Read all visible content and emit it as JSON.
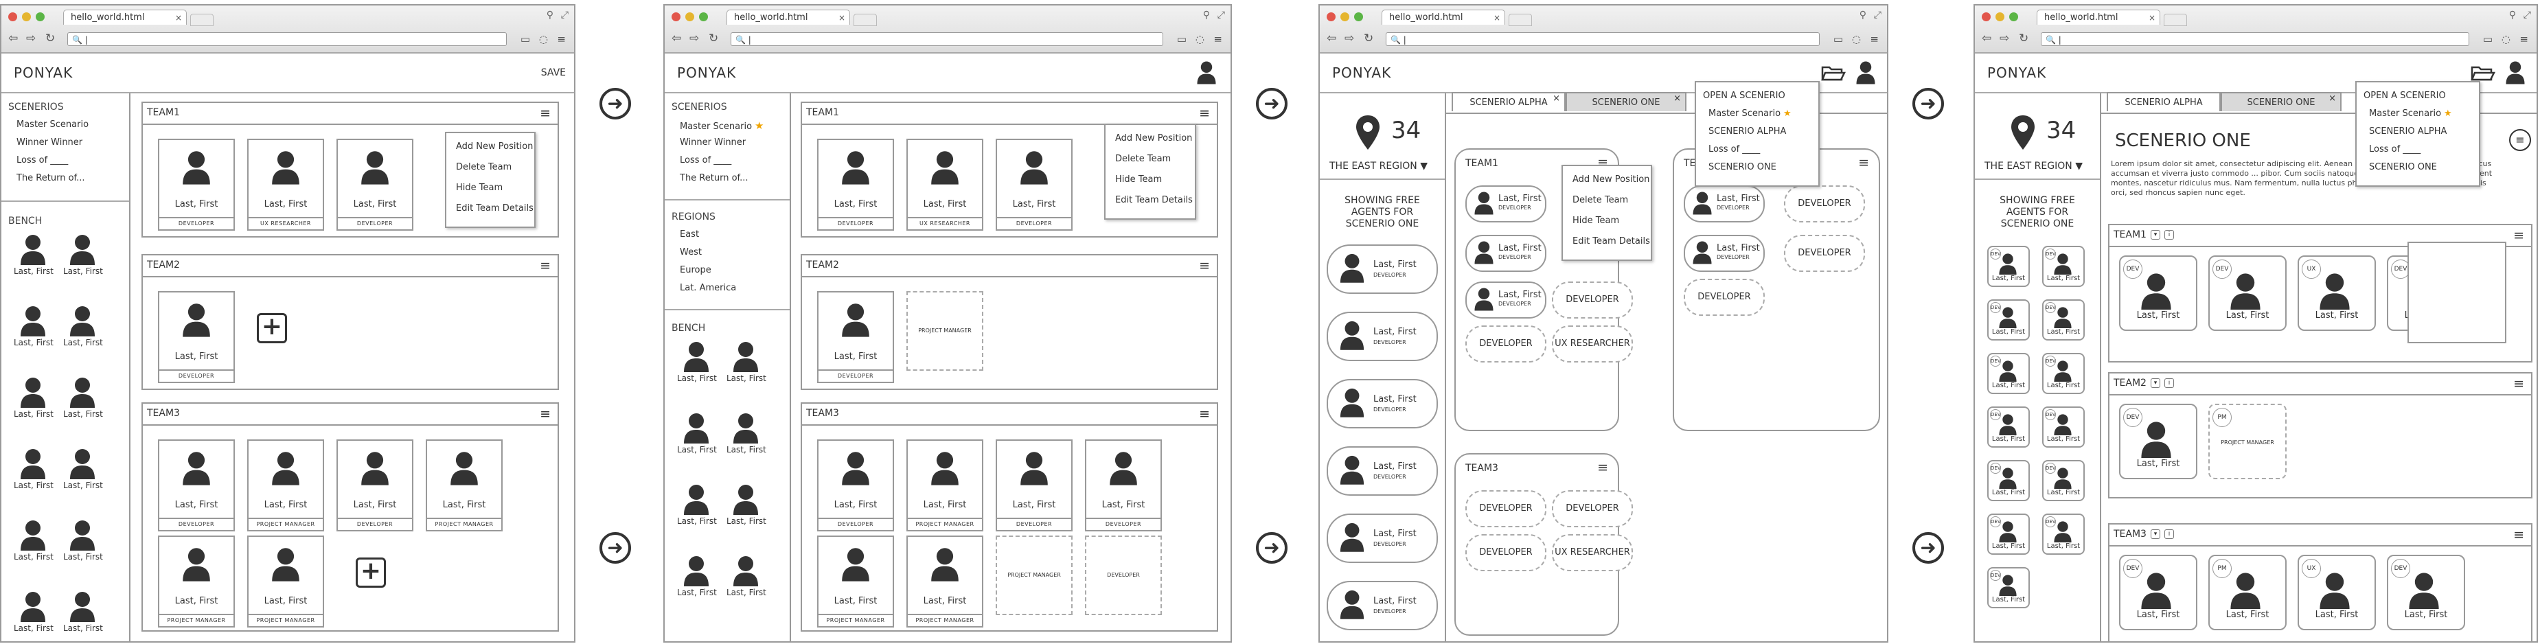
{
  "browser": {
    "tab_title": "hello_world.html",
    "tab_close": "×",
    "url_value": "|"
  },
  "app": {
    "logo": "PONYAK",
    "save": "SAVE"
  },
  "panel1": {
    "sidebar": {
      "scenarios_heading": "SCENERIOS",
      "scenarios": [
        "Master Scenario",
        "Winner Winner",
        "Loss of ____",
        "The Return of..."
      ],
      "bench_heading": "BENCH"
    },
    "teams": [
      {
        "title": "TEAM1",
        "members": [
          {
            "name": "Last, First",
            "role": "DEVELOPER"
          },
          {
            "name": "Last, First",
            "role": "UX RESEARCHER"
          },
          {
            "name": "Last, First",
            "role": "DEVELOPER"
          }
        ]
      },
      {
        "title": "TEAM2",
        "members": [
          {
            "name": "Last, First",
            "role": "DEVELOPER"
          }
        ]
      },
      {
        "title": "TEAM3",
        "members": [
          {
            "name": "Last, First",
            "role": "DEVELOPER"
          },
          {
            "name": "Last, First",
            "role": "PROJECT MANAGER"
          },
          {
            "name": "Last, First",
            "role": "DEVELOPER"
          },
          {
            "name": "Last, First",
            "role": "PROJECT MANAGER"
          },
          {
            "name": "Last, First",
            "role": "PROJECT MANAGER"
          },
          {
            "name": "Last, First",
            "role": "PROJECT MANAGER"
          }
        ]
      }
    ],
    "team_menu": [
      "Add New Position",
      "Delete Team",
      "Hide Team",
      "Edit Team Details"
    ],
    "bench_name": "Last, First",
    "add_symbol": "+"
  },
  "panel2": {
    "sidebar": {
      "scenarios_heading": "SCENERIOS",
      "scenarios": [
        "Master Scenario",
        "Winner Winner",
        "Loss of ____",
        "The Return of..."
      ],
      "star": "★",
      "regions_heading": "REGIONS",
      "regions": [
        "East",
        "West",
        "Europe",
        "Lat. America"
      ],
      "bench_heading": "BENCH"
    },
    "teams": [
      {
        "title": "TEAM1",
        "members": [
          {
            "name": "Last, First",
            "role": "DEVELOPER"
          },
          {
            "name": "Last, First",
            "role": "UX RESEARCHER"
          },
          {
            "name": "Last, First",
            "role": "DEVELOPER"
          }
        ]
      },
      {
        "title": "TEAM2",
        "members": [
          {
            "name": "Last, First",
            "role": "DEVELOPER"
          }
        ],
        "open": [
          "PROJECT MANAGER"
        ]
      },
      {
        "title": "TEAM3",
        "members": [
          {
            "name": "Last, First",
            "role": "DEVELOPER"
          },
          {
            "name": "Last, First",
            "role": "PROJECT MANAGER"
          },
          {
            "name": "Last, First",
            "role": "DEVELOPER"
          },
          {
            "name": "Last, First",
            "role": "DEVELOPER"
          },
          {
            "name": "Last, First",
            "role": "PROJECT MANAGER"
          },
          {
            "name": "Last, First",
            "role": "PROJECT MANAGER"
          }
        ],
        "open": [
          "PROJECT MANAGER",
          "DEVELOPER"
        ]
      }
    ],
    "team_menu": [
      "Add New Position",
      "Delete Team",
      "Hide Team",
      "Edit Team Details"
    ]
  },
  "panel3": {
    "count": "34",
    "region": "THE EAST REGION",
    "showing": [
      "SHOWING FREE",
      "AGENTS FOR",
      "SCENERIO ONE"
    ],
    "agents": [
      {
        "name": "Last, First",
        "role": "DEVELOPER"
      },
      {
        "name": "Last, First",
        "role": "DEVELOPER"
      },
      {
        "name": "Last, First",
        "role": "DEVELOPER"
      },
      {
        "name": "Last, First",
        "role": "DEVELOPER"
      },
      {
        "name": "Last, First",
        "role": "DEVELOPER"
      },
      {
        "name": "Last, First",
        "role": "DEVELOPER"
      }
    ],
    "tabs": [
      "SCENERIO ALPHA",
      "SCENERIO ONE"
    ],
    "scenario_menu": [
      "OPEN A SCENERIO",
      "Master Scenario",
      "SCENERIO ALPHA",
      "Loss of ____",
      "SCENERIO ONE"
    ],
    "team_menu": [
      "Add New Position",
      "Delete Team",
      "Hide Team",
      "Edit Team Details"
    ],
    "team1": {
      "title": "TEAM1",
      "name": "Last, First",
      "role": "DEVELOPER",
      "open": [
        "DEVELOPER",
        "DEVELOPER",
        "UX RESEARCHER"
      ]
    },
    "team2": {
      "title": "TEAM2",
      "name": "Last, First",
      "role": "DEVELOPER",
      "open": [
        "DEVELOPER",
        "DEVELOPER",
        "DEVELOPER"
      ]
    },
    "team3": {
      "title": "TEAM3",
      "open": [
        "DEVELOPER",
        "DEVELOPER",
        "DEVELOPER",
        "UX RESEARCHER"
      ]
    }
  },
  "panel4": {
    "count": "34",
    "region": "THE EAST REGION",
    "showing": [
      "SHOWING FREE",
      "AGENTS FOR",
      "SCENERIO ONE"
    ],
    "tabs": [
      "SCENERIO ALPHA",
      "SCENERIO ONE"
    ],
    "scenario_menu": [
      "OPEN A SCENERIO",
      "Master Scenario",
      "SCENERIO ALPHA",
      "Loss of ____",
      "SCENERIO ONE"
    ],
    "title": "SCENERIO ONE",
    "description": "Lorem ipsum dolor sit amet, consectetur adipiscing elit. Aenean ... Proin gravida dolor sit amet lacus accumsan et viverra justo commodo ... pibor. Cum sociis natoque penatibus et magnis dis parturient montes, nascetur ridiculus mus. Nam fermentum, nulla luctus pharetra vulputate, felis tellus mollis orci, sed rhoncus sapien nunc eget.",
    "mini_name": "Last, First",
    "mini_badge": "DEV",
    "teams": [
      {
        "title": "TEAM1",
        "cards": [
          {
            "badge": "DEV",
            "name": "Last, First"
          },
          {
            "badge": "DEV",
            "name": "Last, First"
          },
          {
            "badge": "UX",
            "name": "Last, First"
          },
          {
            "badge": "DEV",
            "name": "Last, First"
          }
        ]
      },
      {
        "title": "TEAM2",
        "cards": [
          {
            "badge": "DEV",
            "name": "Last, First"
          }
        ],
        "open": [
          {
            "badge": "PM",
            "label": "PROJECT MANAGER"
          }
        ]
      },
      {
        "title": "TEAM3",
        "cards": [
          {
            "badge": "DEV",
            "name": "Last, First"
          },
          {
            "badge": "PM",
            "name": "Last, First"
          },
          {
            "badge": "UX",
            "name": "Last, First"
          },
          {
            "badge": "DEV",
            "name": "Last, First"
          }
        ]
      }
    ]
  },
  "colors": {
    "star": "#f0a400",
    "border": "#999999"
  }
}
